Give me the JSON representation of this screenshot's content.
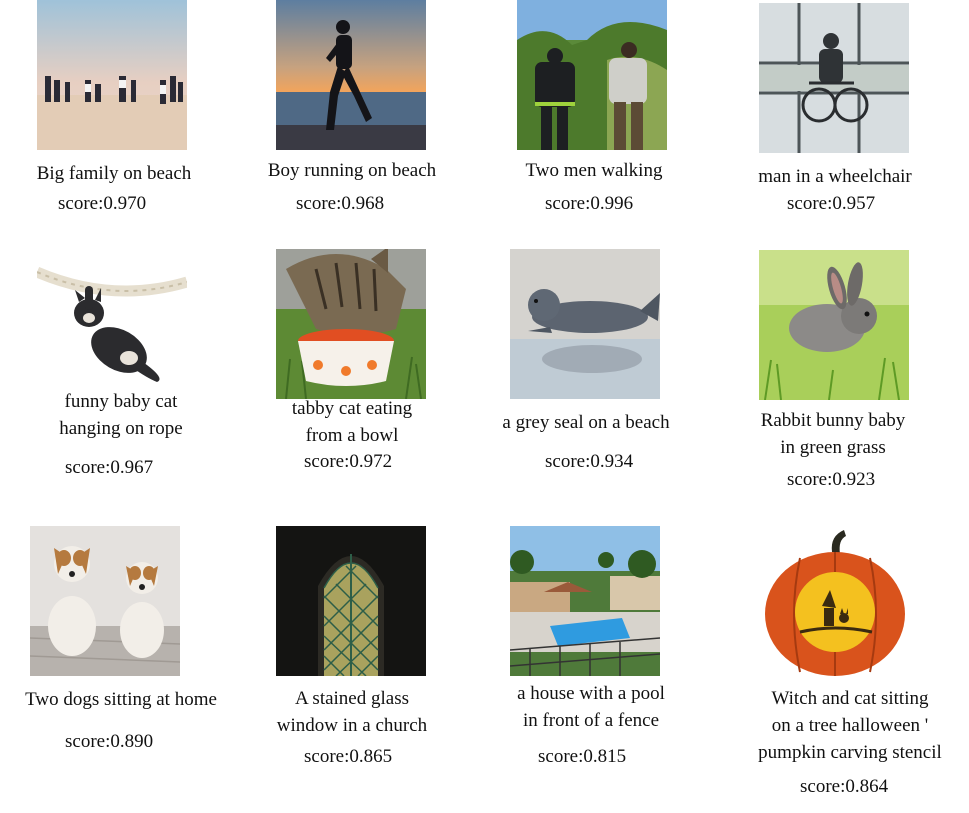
{
  "items": [
    {
      "image": "family-beach-photo",
      "caption": [
        "Big family on beach"
      ],
      "score_label": "score:0.970"
    },
    {
      "image": "boy-running-beach-photo",
      "caption": [
        "Boy running on beach"
      ],
      "score_label": "score:0.968"
    },
    {
      "image": "two-men-walking-photo",
      "caption": [
        "Two men walking"
      ],
      "score_label": "score:0.996"
    },
    {
      "image": "wheelchair-photo",
      "caption": [
        "man in a wheelchair"
      ],
      "score_label": "score:0.957"
    },
    {
      "image": "cat-on-rope-photo",
      "caption": [
        "funny baby cat",
        "hanging on rope"
      ],
      "score_label": "score:0.967"
    },
    {
      "image": "tabby-cat-bowl-photo",
      "caption": [
        "tabby cat eating",
        "from a bowl"
      ],
      "score_label": "score:0.972"
    },
    {
      "image": "grey-seal-photo",
      "caption": [
        "a grey seal on a beach"
      ],
      "score_label": "score:0.934"
    },
    {
      "image": "rabbit-grass-photo",
      "caption": [
        "Rabbit bunny baby",
        "in green grass"
      ],
      "score_label": "score:0.923"
    },
    {
      "image": "two-dogs-photo",
      "caption": [
        "Two dogs sitting at home"
      ],
      "score_label": "score:0.890"
    },
    {
      "image": "stained-glass-window-photo",
      "caption": [
        "A stained glass",
        "window in a church"
      ],
      "score_label": "score:0.865"
    },
    {
      "image": "house-pool-photo",
      "caption": [
        "a house with a pool",
        "in front of a fence"
      ],
      "score_label": "score:0.815"
    },
    {
      "image": "halloween-pumpkin-photo",
      "caption": [
        "Witch and cat sitting",
        "on a tree halloween '",
        "pumpkin carving stencil"
      ],
      "score_label": "score:0.864"
    }
  ]
}
